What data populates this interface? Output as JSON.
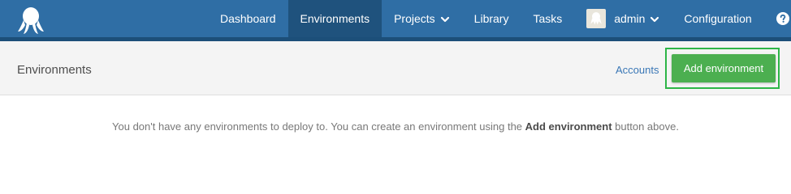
{
  "topbar": {
    "logo_icon": "octopus-logo-icon",
    "nav": {
      "dashboard": "Dashboard",
      "environments": "Environments",
      "projects": "Projects",
      "library": "Library",
      "tasks": "Tasks",
      "user": "admin",
      "configuration": "Configuration"
    },
    "help_icon": "question-circle-icon",
    "colors": {
      "bar": "#2f6ea5",
      "active": "#1f527d",
      "border": "#1c4f79"
    }
  },
  "header": {
    "title": "Environments",
    "accounts_link": "Accounts",
    "add_button": "Add environment",
    "button_color": "#4caf50",
    "highlight_color": "#2db547"
  },
  "main": {
    "empty_prefix": "You don't have any environments to deploy to. You can create an environment using the ",
    "empty_bold": "Add environment",
    "empty_suffix": " button above."
  }
}
